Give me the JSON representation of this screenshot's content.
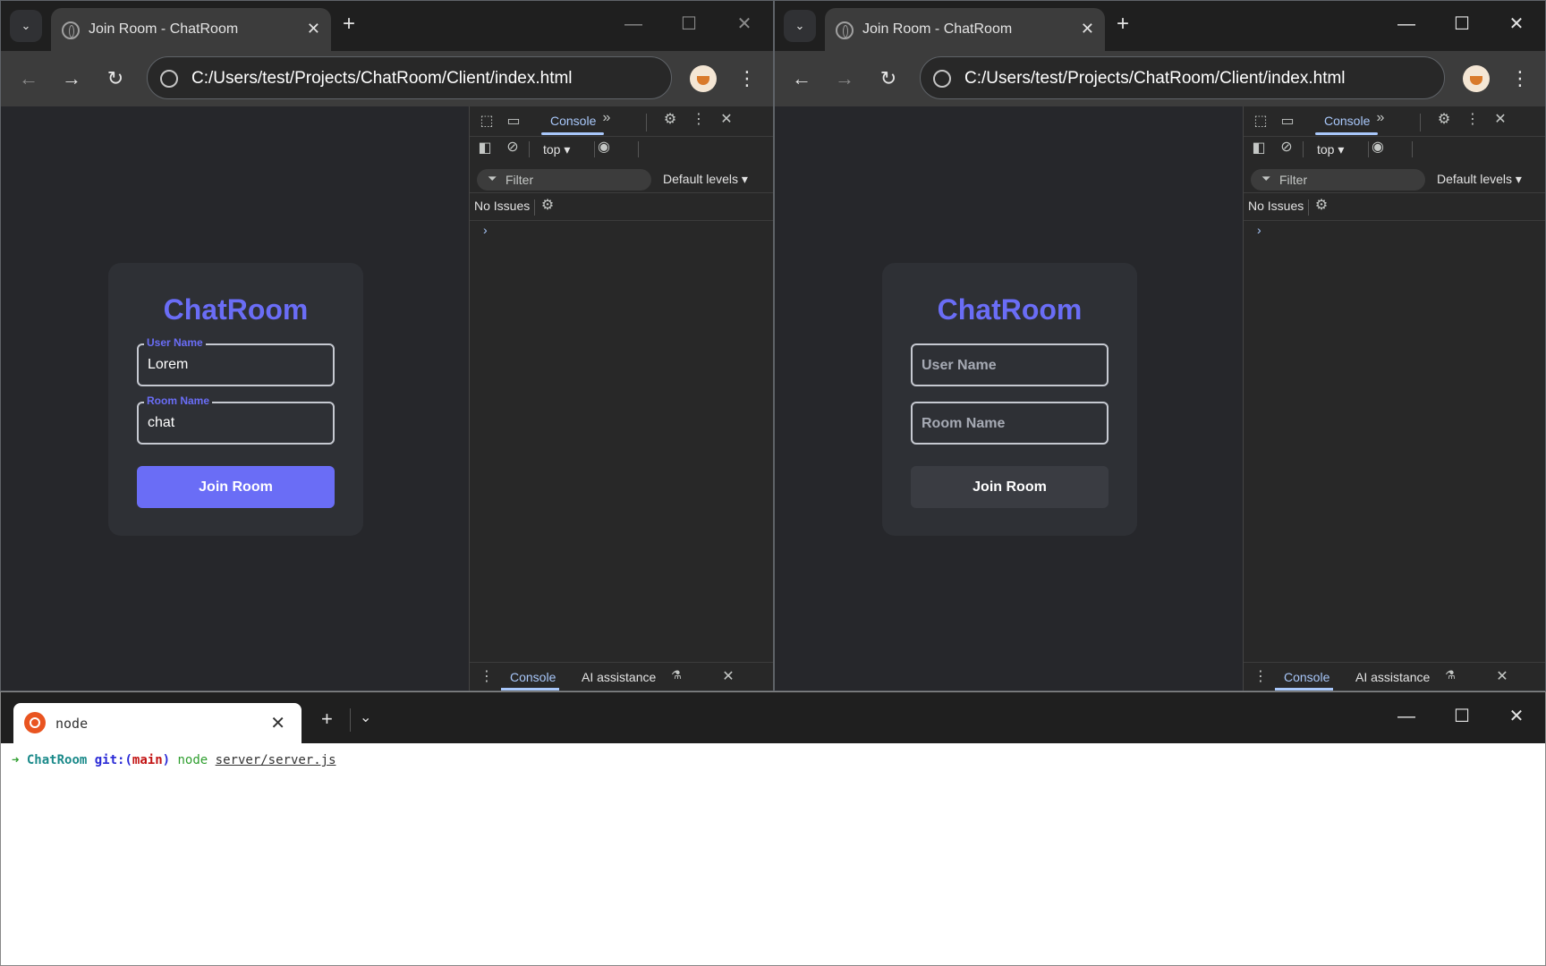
{
  "browser_left": {
    "tab_title": "Join Room - ChatRoom",
    "url": "C:/Users/test/Projects/ChatRoom/Client/index.html",
    "app": {
      "title": "ChatRoom",
      "user_name_label": "User Name",
      "user_name_value": "Lorem",
      "room_name_label": "Room Name",
      "room_name_value": "chat",
      "join_button": "Join Room"
    }
  },
  "browser_right": {
    "tab_title": "Join Room - ChatRoom",
    "url": "C:/Users/test/Projects/ChatRoom/Client/index.html",
    "app": {
      "title": "ChatRoom",
      "user_name_placeholder": "User Name",
      "room_name_placeholder": "Room Name",
      "join_button": "Join Room"
    }
  },
  "devtools": {
    "tab_console": "Console",
    "context": "top",
    "filter_placeholder": "Filter",
    "levels": "Default levels",
    "issues": "No Issues",
    "prompt": "›",
    "drawer_console": "Console",
    "drawer_ai": "AI assistance"
  },
  "terminal": {
    "tab_title": "node",
    "arrow": "➜",
    "dir": "ChatRoom",
    "git_label": "git:(",
    "branch": "main",
    "git_close": ")",
    "command": "node",
    "argument": "server/server.js"
  },
  "colors": {
    "accent": "#6a6df6",
    "page_bg": "#26272b",
    "card_bg": "#2e3035",
    "devtools_accent": "#a8c7fa"
  },
  "icons": {
    "tab_search": "chevron-down-icon",
    "favicon": "globe-icon",
    "back": "arrow-left-icon",
    "forward": "arrow-right-icon",
    "reload": "reload-icon",
    "site_info": "globe-icon",
    "profile": "avatar-icon",
    "menu": "kebab-menu-icon",
    "terminal": "ubuntu-icon"
  }
}
